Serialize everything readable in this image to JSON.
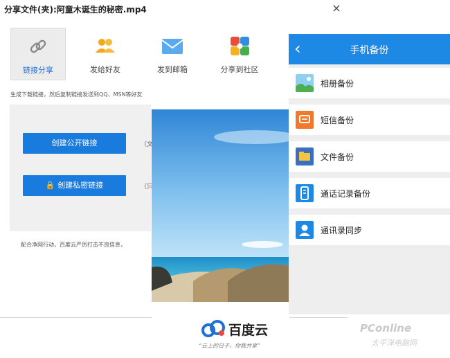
{
  "dialog": {
    "title": "分享文件(夹):阿童木诞生的秘密.mp4",
    "close_glyph": "×",
    "tabs": [
      {
        "label": "链接分享",
        "icon": "link-icon",
        "active": true
      },
      {
        "label": "发给好友",
        "icon": "friends-icon",
        "active": false
      },
      {
        "label": "发到邮箱",
        "icon": "mail-icon",
        "active": false
      },
      {
        "label": "分享到社区",
        "icon": "community-icon",
        "active": false
      }
    ],
    "hint": "生成下载链接，然后复制链接发送到QQ、MSN等好友",
    "public_link_button": "创建公开链接",
    "public_link_note": "（文",
    "private_link_button": "创建私密链接",
    "private_link_note": "（只",
    "footer_note": "配合净网行动，百度云严厉打击不良信息，"
  },
  "promo": {
    "logo_text": "百度云",
    "slogan": "“云上的日子，你我共享”"
  },
  "mobile": {
    "title": "手机备份",
    "back_glyph": "‹",
    "items": [
      {
        "label": "相册备份",
        "icon": "photo-icon",
        "color": "#4caf50"
      },
      {
        "label": "短信备份",
        "icon": "sms-icon",
        "color": "#f07a2a"
      },
      {
        "label": "文件备份",
        "icon": "folder-icon",
        "color": "#3a6fc4"
      },
      {
        "label": "通话记录备份",
        "icon": "call-log-icon",
        "color": "#1e88e5"
      },
      {
        "label": "通讯录同步",
        "icon": "contacts-icon",
        "color": "#1e88e5"
      }
    ]
  },
  "watermark": {
    "brand": "PConline",
    "sub": "太平洋电脑网"
  },
  "colors": {
    "accent": "#1a7bde",
    "mobile_header": "#1e88e5"
  }
}
